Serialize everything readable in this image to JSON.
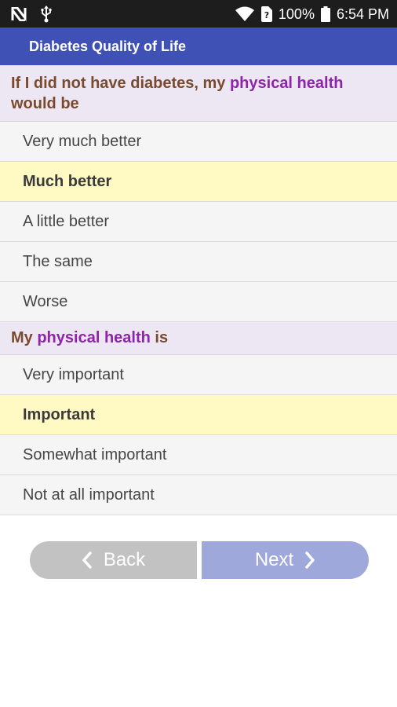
{
  "status_bar": {
    "battery": "100%",
    "time": "6:54 PM"
  },
  "app_bar": {
    "title": "Diabetes Quality of Life"
  },
  "questions": [
    {
      "text_before": "If I did not have diabetes, my ",
      "highlight": "physical health",
      "text_after": " would be",
      "options": [
        "Very much better",
        "Much better",
        "A little better",
        "The same",
        "Worse"
      ],
      "selected": "Much better"
    },
    {
      "text_before": "My ",
      "highlight": "physical health",
      "text_after": " is",
      "options": [
        "Very important",
        "Important",
        "Somewhat important",
        "Not at all important"
      ],
      "selected": "Important"
    }
  ],
  "navigation": {
    "back_label": "Back",
    "next_label": "Next"
  },
  "colors": {
    "app_bar": "#3f51b5",
    "question_bg": "#ede7f3",
    "question_text": "#7a4a2e",
    "highlight": "#8e24aa",
    "selected_bg": "#fff9c4",
    "back_button": "#c2c2c2",
    "next_button": "#9fa8da"
  }
}
